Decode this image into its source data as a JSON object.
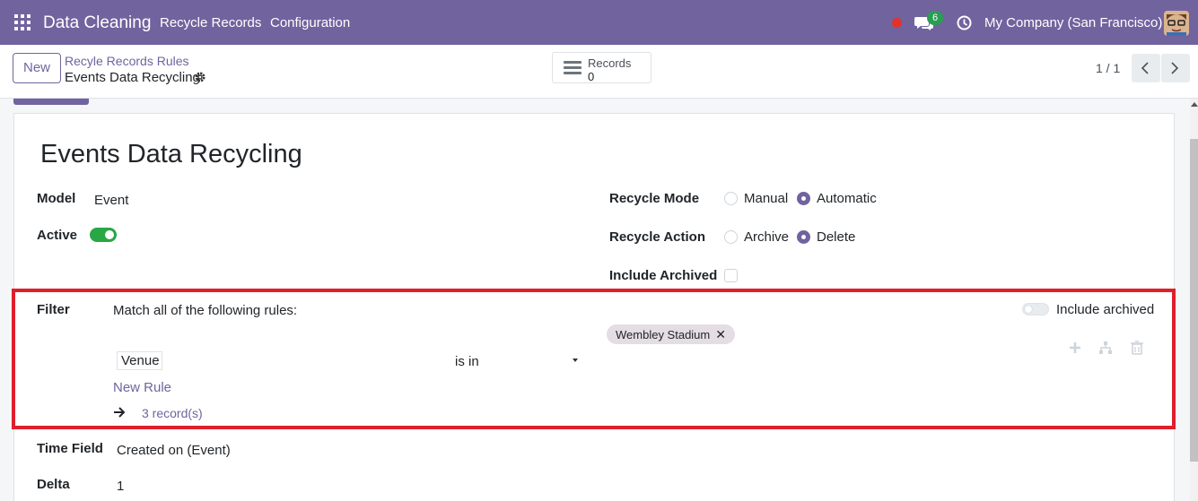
{
  "navbar": {
    "brand": "Data Cleaning",
    "menu": [
      "Recycle Records",
      "Configuration"
    ],
    "chat_count": "6",
    "company": "My Company (San Francisco)"
  },
  "control_panel": {
    "new_label": "New",
    "breadcrumb_parent": "Recyle Records Rules",
    "breadcrumb_current": "Events Data Recycling",
    "stat_label": "Records",
    "stat_value": "0",
    "pager": "1 / 1"
  },
  "form": {
    "title": "Events Data Recycling",
    "model_label": "Model",
    "model_value": "Event",
    "active_label": "Active",
    "active": true,
    "recycle_mode_label": "Recycle Mode",
    "recycle_mode_options": [
      "Manual",
      "Automatic"
    ],
    "recycle_mode_selected": "Automatic",
    "recycle_action_label": "Recycle Action",
    "recycle_action_options": [
      "Archive",
      "Delete"
    ],
    "recycle_action_selected": "Delete",
    "include_archived_label": "Include Archived",
    "include_archived": false,
    "filter": {
      "label": "Filter",
      "match_text": "Match all of the following rules:",
      "include_archived_toggle_label": "Include archived",
      "include_archived_toggle": false,
      "rule_field": "Venue",
      "rule_operator": "is in",
      "rule_tag": "Wembley Stadium",
      "new_rule": "New Rule",
      "records_link": "3 record(s)"
    },
    "time_field_label": "Time Field",
    "time_field_value": "Created on (Event)",
    "delta_label": "Delta",
    "delta_value": "1"
  },
  "colors": {
    "brand": "#71639e",
    "highlight": "#e01f2c",
    "toggle_on": "#28a745"
  }
}
